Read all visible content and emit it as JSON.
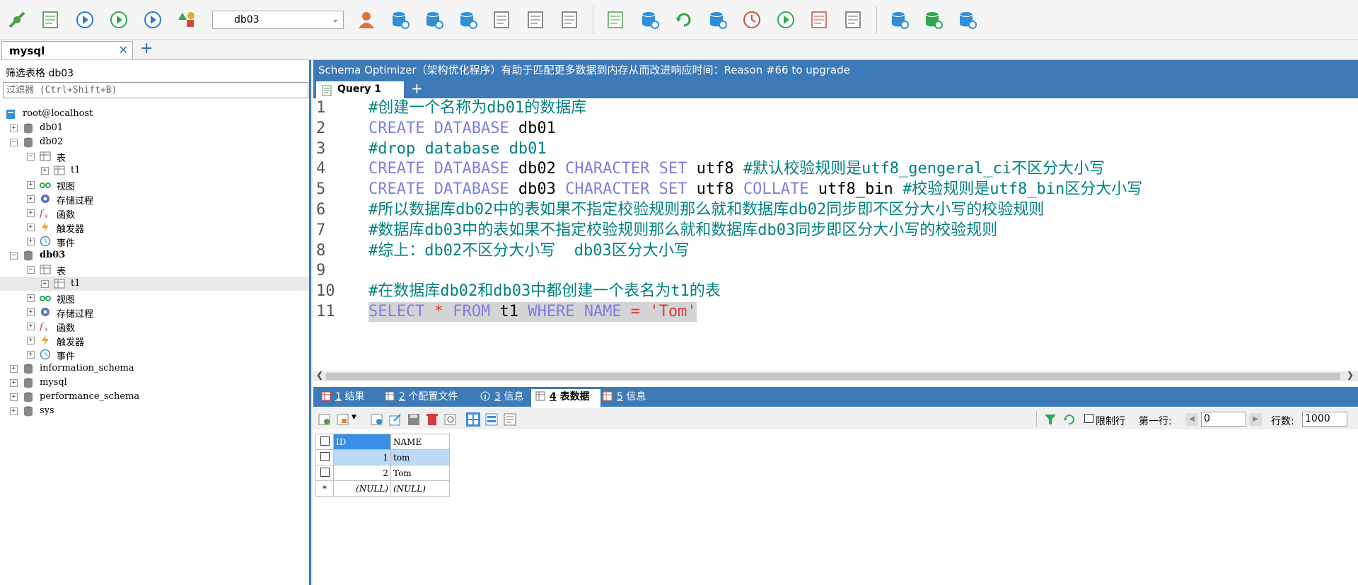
{
  "toolbar": {
    "buttons": [
      {
        "name": "connect-icon",
        "color": "#4aa04a"
      },
      {
        "name": "new-query-icon",
        "color": "#3a8a3a"
      },
      {
        "name": "execute-icon",
        "color": "#2a7bd4"
      },
      {
        "name": "execute-all-icon",
        "color": "#2fa84f"
      },
      {
        "name": "execute-explain-icon",
        "color": "#2a7bd4"
      },
      {
        "name": "schema-designer-icon",
        "color": "#d04a3a"
      }
    ],
    "database_selector": {
      "value": "db03"
    },
    "buttons2": [
      {
        "name": "user-manager-icon",
        "color": "#e0703a"
      },
      {
        "name": "import-db-icon",
        "color": "#2f8fd8"
      },
      {
        "name": "export-db-icon",
        "color": "#2f8fd8"
      },
      {
        "name": "backup-db-icon",
        "color": "#2f8fd8"
      },
      {
        "name": "table-diagram-icon",
        "color": "#6a6a6a"
      },
      {
        "name": "table-grid-icon",
        "color": "#6a6a6a"
      },
      {
        "name": "schema-grid-icon",
        "color": "#6a6a6a"
      }
    ],
    "buttons3": [
      {
        "name": "query-builder-icon",
        "color": "#4aa04a"
      },
      {
        "name": "sync-schema-icon",
        "color": "#2f8fd8"
      },
      {
        "name": "refresh-icon",
        "color": "#2fa84f"
      },
      {
        "name": "copy-db-icon",
        "color": "#2f8fd8"
      },
      {
        "name": "scheduler-icon",
        "color": "#d04a3a"
      },
      {
        "name": "job-agent-icon",
        "color": "#2fa84f"
      },
      {
        "name": "data-report-icon",
        "color": "#d04a3a"
      },
      {
        "name": "compare-icon",
        "color": "#6a6a6a"
      }
    ],
    "buttons4": [
      {
        "name": "db-tools-icon",
        "color": "#2f8fd8"
      },
      {
        "name": "db-check-icon",
        "color": "#2fa84f"
      },
      {
        "name": "db-sync-icon",
        "color": "#2f8fd8"
      }
    ]
  },
  "connection_tab": {
    "label": "mysql",
    "close": "✕",
    "add": "+"
  },
  "left": {
    "filter_title": "筛选表格 db03",
    "filter_placeholder": "过滤器 (Ctrl+Shift+B)",
    "tree": [
      {
        "label": "root@localhost",
        "indent": 0,
        "icon": "server-icon",
        "exp": ""
      },
      {
        "label": "db01",
        "indent": 1,
        "icon": "database-icon",
        "exp": "+"
      },
      {
        "label": "db02",
        "indent": 1,
        "icon": "database-icon",
        "exp": "-"
      },
      {
        "label": "表",
        "indent": 2,
        "icon": "table-folder-icon",
        "exp": "-"
      },
      {
        "label": "t1",
        "indent": 3,
        "icon": "table-icon",
        "exp": "+"
      },
      {
        "label": "视图",
        "indent": 2,
        "icon": "view-icon",
        "exp": "+"
      },
      {
        "label": "存储过程",
        "indent": 2,
        "icon": "procedure-icon",
        "exp": "+"
      },
      {
        "label": "函数",
        "indent": 2,
        "icon": "function-icon",
        "exp": "+"
      },
      {
        "label": "触发器",
        "indent": 2,
        "icon": "trigger-icon",
        "exp": "+"
      },
      {
        "label": "事件",
        "indent": 2,
        "icon": "event-icon",
        "exp": "+"
      },
      {
        "label": "db03",
        "indent": 1,
        "icon": "database-icon",
        "exp": "-",
        "bold": true
      },
      {
        "label": "表",
        "indent": 2,
        "icon": "table-folder-icon",
        "exp": "-"
      },
      {
        "label": "t1",
        "indent": 3,
        "icon": "table-icon",
        "exp": "+",
        "selected": true
      },
      {
        "label": "视图",
        "indent": 2,
        "icon": "view-icon",
        "exp": "+"
      },
      {
        "label": "存储过程",
        "indent": 2,
        "icon": "procedure-icon",
        "exp": "+"
      },
      {
        "label": "函数",
        "indent": 2,
        "icon": "function-icon",
        "exp": "+"
      },
      {
        "label": "触发器",
        "indent": 2,
        "icon": "trigger-icon",
        "exp": "+"
      },
      {
        "label": "事件",
        "indent": 2,
        "icon": "event-icon",
        "exp": "+"
      },
      {
        "label": "information_schema",
        "indent": 1,
        "icon": "database-icon",
        "exp": "+"
      },
      {
        "label": "mysql",
        "indent": 1,
        "icon": "database-icon",
        "exp": "+"
      },
      {
        "label": "performance_schema",
        "indent": 1,
        "icon": "database-icon",
        "exp": "+"
      },
      {
        "label": "sys",
        "indent": 1,
        "icon": "database-icon",
        "exp": "+"
      }
    ]
  },
  "banner": "Schema Optimizer（架构优化程序）有助于匹配更多数据到内存从而改进响应时间：Reason #66 to upgrade",
  "query_tab": {
    "label": "Query 1",
    "add": "+"
  },
  "editor": {
    "lines": [
      {
        "n": "1",
        "tokens": [
          {
            "t": "#创建一个名称为db01的数据库",
            "c": "cm"
          }
        ]
      },
      {
        "n": "2",
        "tokens": [
          {
            "t": "CREATE DATABASE ",
            "c": "kw"
          },
          {
            "t": "db01",
            "c": "plain"
          }
        ]
      },
      {
        "n": "3",
        "tokens": [
          {
            "t": "#drop database db01",
            "c": "cm"
          }
        ]
      },
      {
        "n": "4",
        "tokens": [
          {
            "t": "CREATE DATABASE ",
            "c": "kw"
          },
          {
            "t": "db02 ",
            "c": "plain"
          },
          {
            "t": "CHARACTER SET ",
            "c": "kw"
          },
          {
            "t": "utf8 ",
            "c": "plain"
          },
          {
            "t": "#默认校验规则是utf8_gengeral_ci不区分大小写",
            "c": "cm"
          }
        ]
      },
      {
        "n": "5",
        "tokens": [
          {
            "t": "CREATE DATABASE ",
            "c": "kw"
          },
          {
            "t": "db03 ",
            "c": "plain"
          },
          {
            "t": "CHARACTER SET ",
            "c": "kw"
          },
          {
            "t": "utf8 ",
            "c": "plain"
          },
          {
            "t": "COLLATE ",
            "c": "kw"
          },
          {
            "t": "utf8_bin ",
            "c": "plain"
          },
          {
            "t": "#校验规则是utf8_bin区分大小写",
            "c": "cm"
          }
        ]
      },
      {
        "n": "6",
        "tokens": [
          {
            "t": "#所以数据库db02中的表如果不指定校验规则那么就和数据库db02同步即不区分大小写的校验规则",
            "c": "cm"
          }
        ]
      },
      {
        "n": "7",
        "tokens": [
          {
            "t": "#数据库db03中的表如果不指定校验规则那么就和数据库db03同步即区分大小写的校验规则",
            "c": "cm"
          }
        ]
      },
      {
        "n": "8",
        "tokens": [
          {
            "t": "#综上：db02不区分大小写  db03区分大小写",
            "c": "cm"
          }
        ]
      },
      {
        "n": "9",
        "tokens": []
      },
      {
        "n": "10",
        "tokens": [
          {
            "t": "#在数据库db02和db03中都创建一个表名为t1的表",
            "c": "cm"
          }
        ]
      },
      {
        "n": "11",
        "selected": true,
        "tokens": [
          {
            "t": "SELECT ",
            "c": "kw"
          },
          {
            "t": "* ",
            "c": "op"
          },
          {
            "t": "FROM ",
            "c": "kw"
          },
          {
            "t": "t1 ",
            "c": "plain"
          },
          {
            "t": "WHERE ",
            "c": "kw"
          },
          {
            "t": "NAME ",
            "c": "kw"
          },
          {
            "t": "= ",
            "c": "op"
          },
          {
            "t": "'Tom'",
            "c": "str"
          }
        ]
      }
    ]
  },
  "result_tabs": [
    {
      "num": "1",
      "label": " 结果",
      "icon": "result-grid-icon",
      "active": false
    },
    {
      "num": "2",
      "label": " 个配置文件",
      "icon": "profile-icon",
      "active": false
    },
    {
      "num": "3",
      "label": " 信息",
      "icon": "info-icon",
      "active": false
    },
    {
      "num": "4",
      "label": " 表数据",
      "icon": "table-data-icon",
      "active": true
    },
    {
      "num": "5",
      "label": " 信息",
      "icon": "info-icon-2",
      "active": false
    }
  ],
  "result_toolbar": {
    "limit_label": "限制行",
    "first_row_label": "第一行:",
    "first_row_value": "0",
    "rows_label": "行数:",
    "rows_value": "1000"
  },
  "grid": {
    "columns": [
      "ID",
      "NAME"
    ],
    "rows": [
      {
        "id": "1",
        "name": "tom",
        "selected": true
      },
      {
        "id": "2",
        "name": "Tom"
      },
      {
        "id": "(NULL)",
        "name": "(NULL)",
        "marker": "*"
      }
    ]
  },
  "colors": {
    "accent": "#3d7ab8",
    "keyword": "#7f7fe0",
    "comment": "#008080",
    "string": "#e03a3a"
  }
}
